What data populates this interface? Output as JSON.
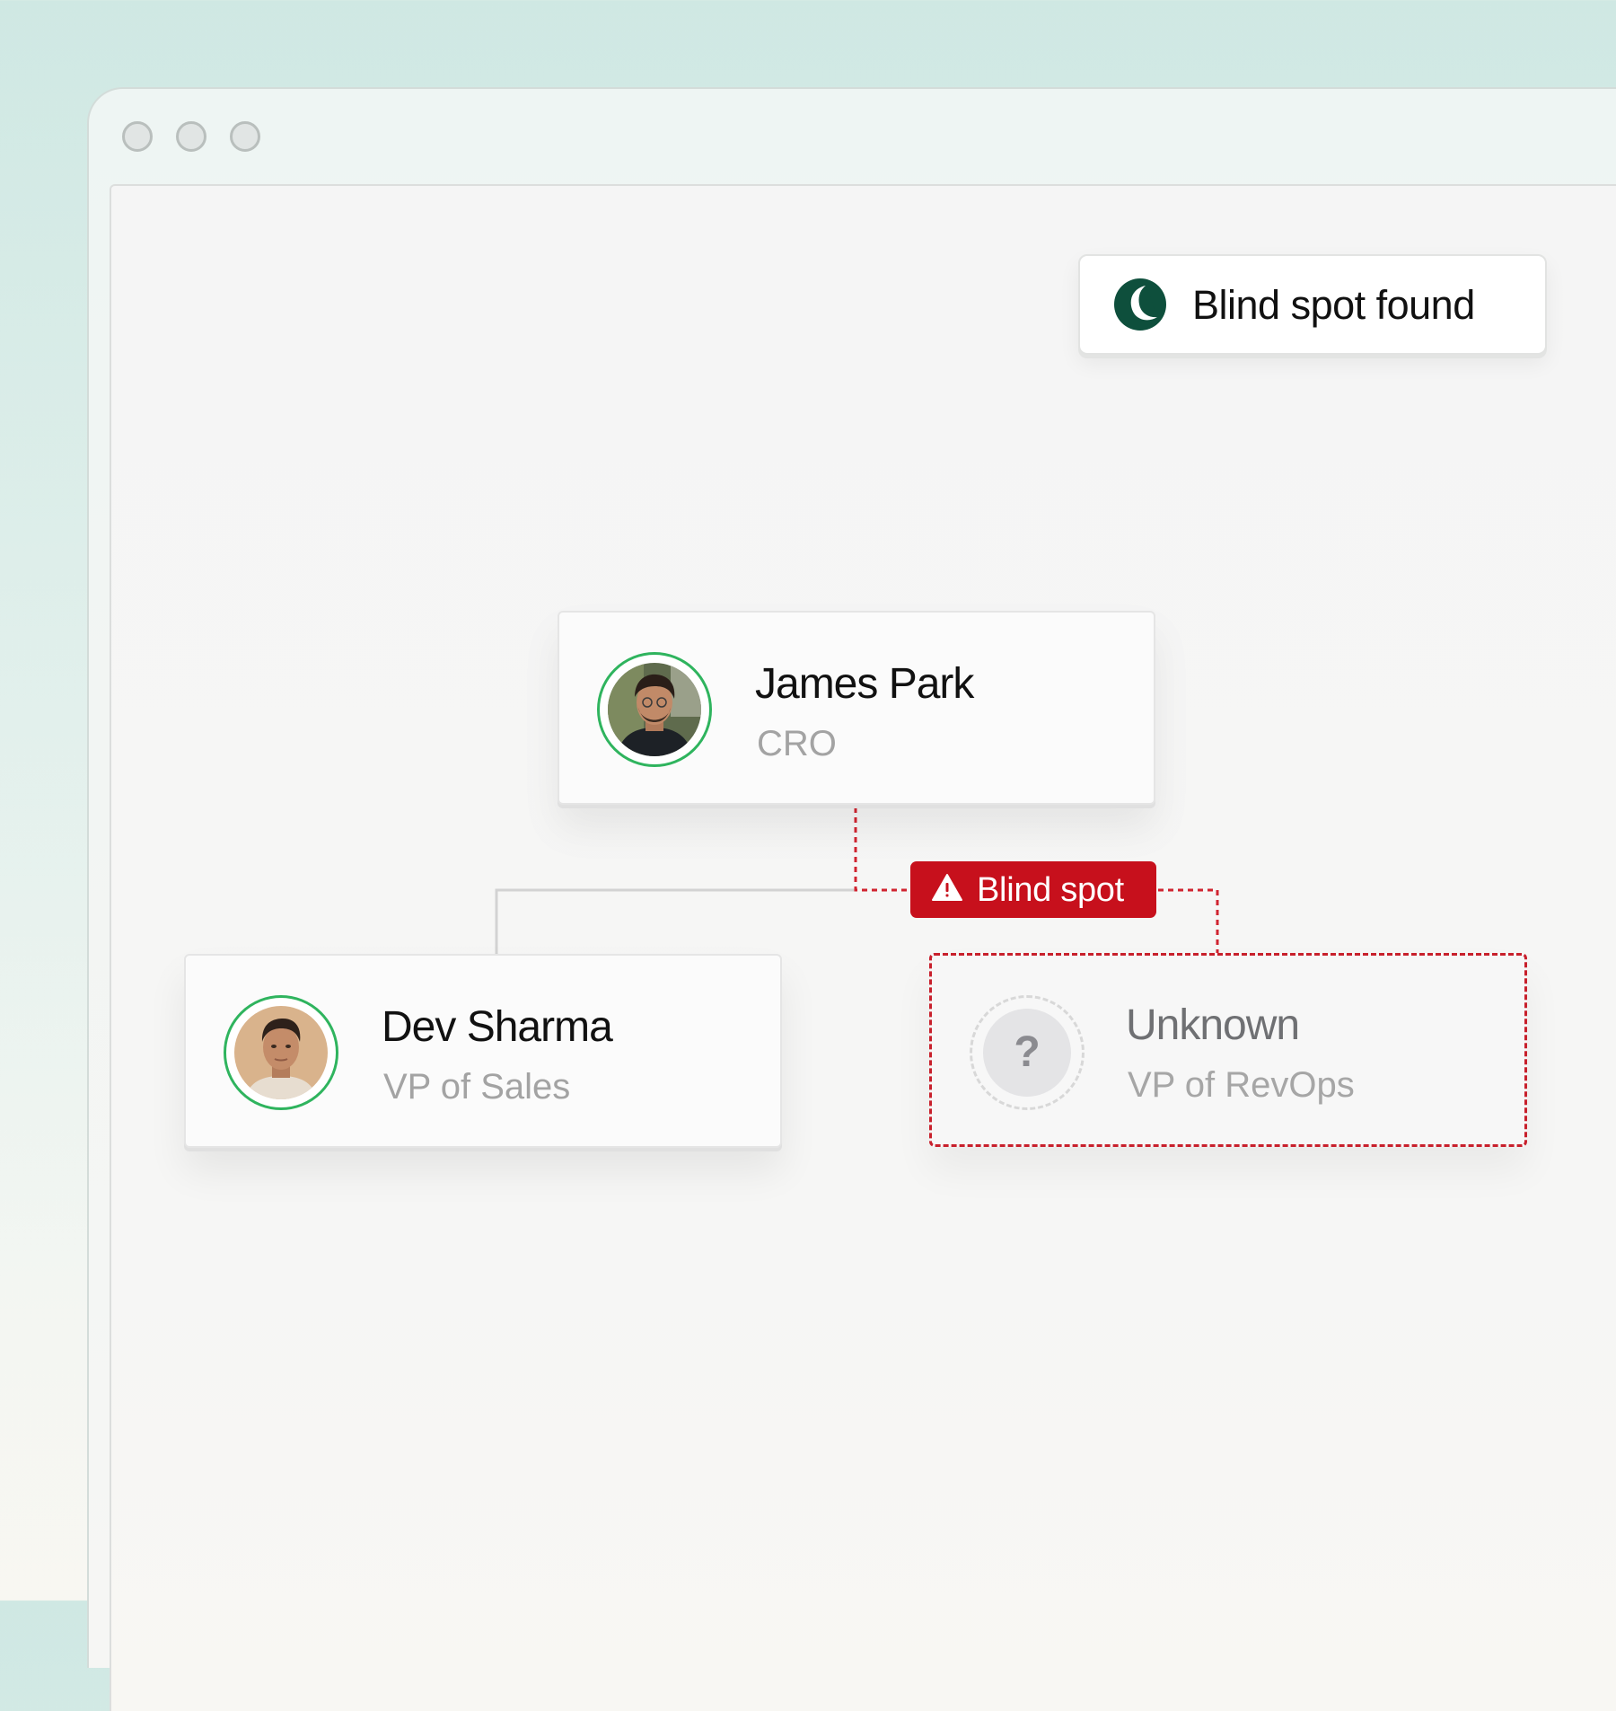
{
  "window": {
    "controls": [
      "close-dot",
      "minimize-dot",
      "maximize-dot"
    ]
  },
  "toast": {
    "text": "Blind spot found",
    "logo_color": "#0e4f3c"
  },
  "org_chart": {
    "root": {
      "name": "James Park",
      "title": "CRO",
      "avatar": "photo",
      "status_color": "#2fb45e"
    },
    "reports": [
      {
        "name": "Dev Sharma",
        "title": "VP of Sales",
        "avatar": "photo",
        "status_color": "#2fb45e"
      },
      {
        "name": "Unknown",
        "title": "VP of RevOps",
        "avatar_placeholder": "?",
        "status": "blind spot"
      }
    ],
    "blind_spot_badge": {
      "label": "Blind spot",
      "icon": "warning-triangle-icon",
      "color": "#c7101c"
    }
  }
}
